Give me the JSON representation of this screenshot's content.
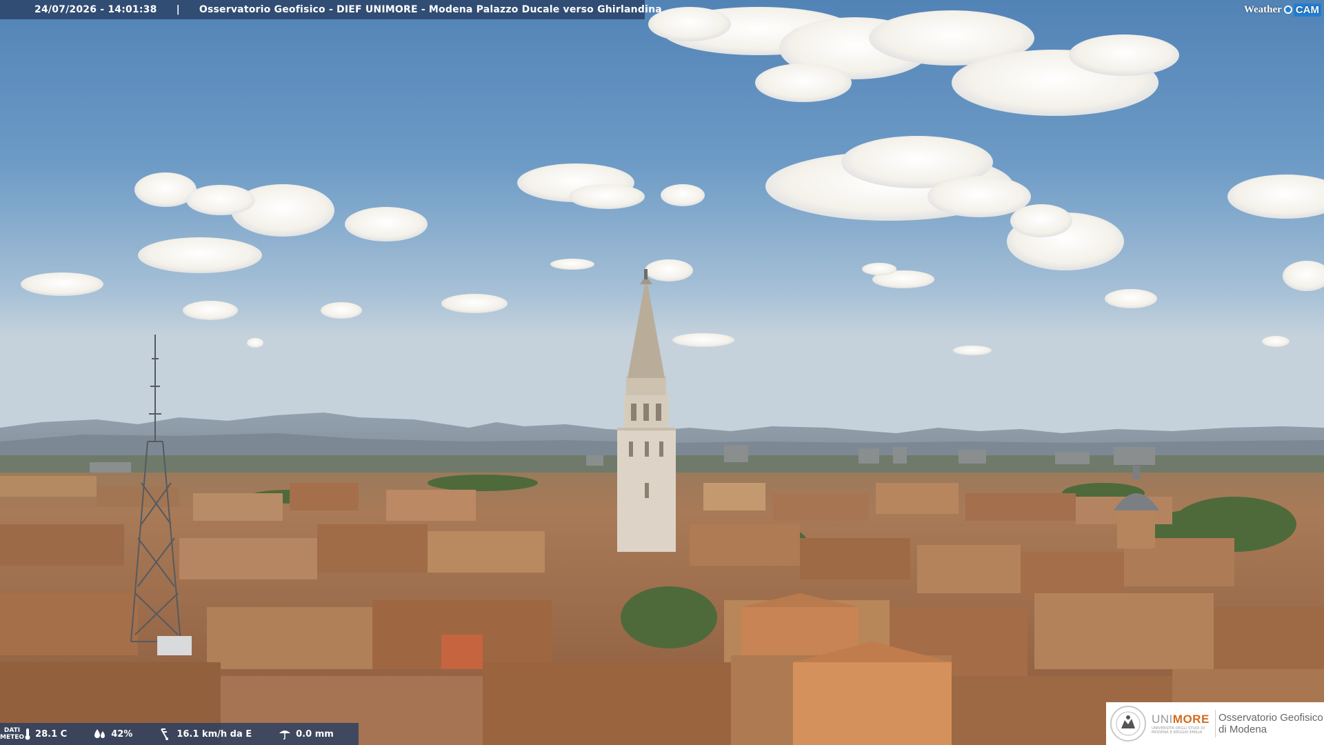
{
  "caption": {
    "timestamp": "24/07/2026 - 14:01:38",
    "separator": "|",
    "title": "Osservatorio Geofisico - DIEF UNIMORE - Modena Palazzo Ducale verso Ghirlandina"
  },
  "brand": {
    "weather_text": "Weather",
    "cam_text": "CAM"
  },
  "weather": {
    "label": "DATI METEO",
    "temperature": "28.1 C",
    "humidity": "42%",
    "wind": "16.1 km/h da E",
    "rain": "0.0 mm",
    "icons": [
      "thermometer-icon",
      "humidity-icon",
      "wind-icon",
      "rain-icon"
    ]
  },
  "logo": {
    "university_prefix": "UNI",
    "university_suffix": "MORE",
    "university_subtitle": "UNIVERSITÀ DEGLI STUDI DI MODENA E REGGIO EMILIA",
    "observatory_line1": "Osservatorio Geofisico",
    "observatory_line2": "di Modena"
  },
  "colors": {
    "bar_background": "#283e62",
    "brand_accent": "#1f7fd6",
    "unimore_orange": "#d46a1c"
  }
}
